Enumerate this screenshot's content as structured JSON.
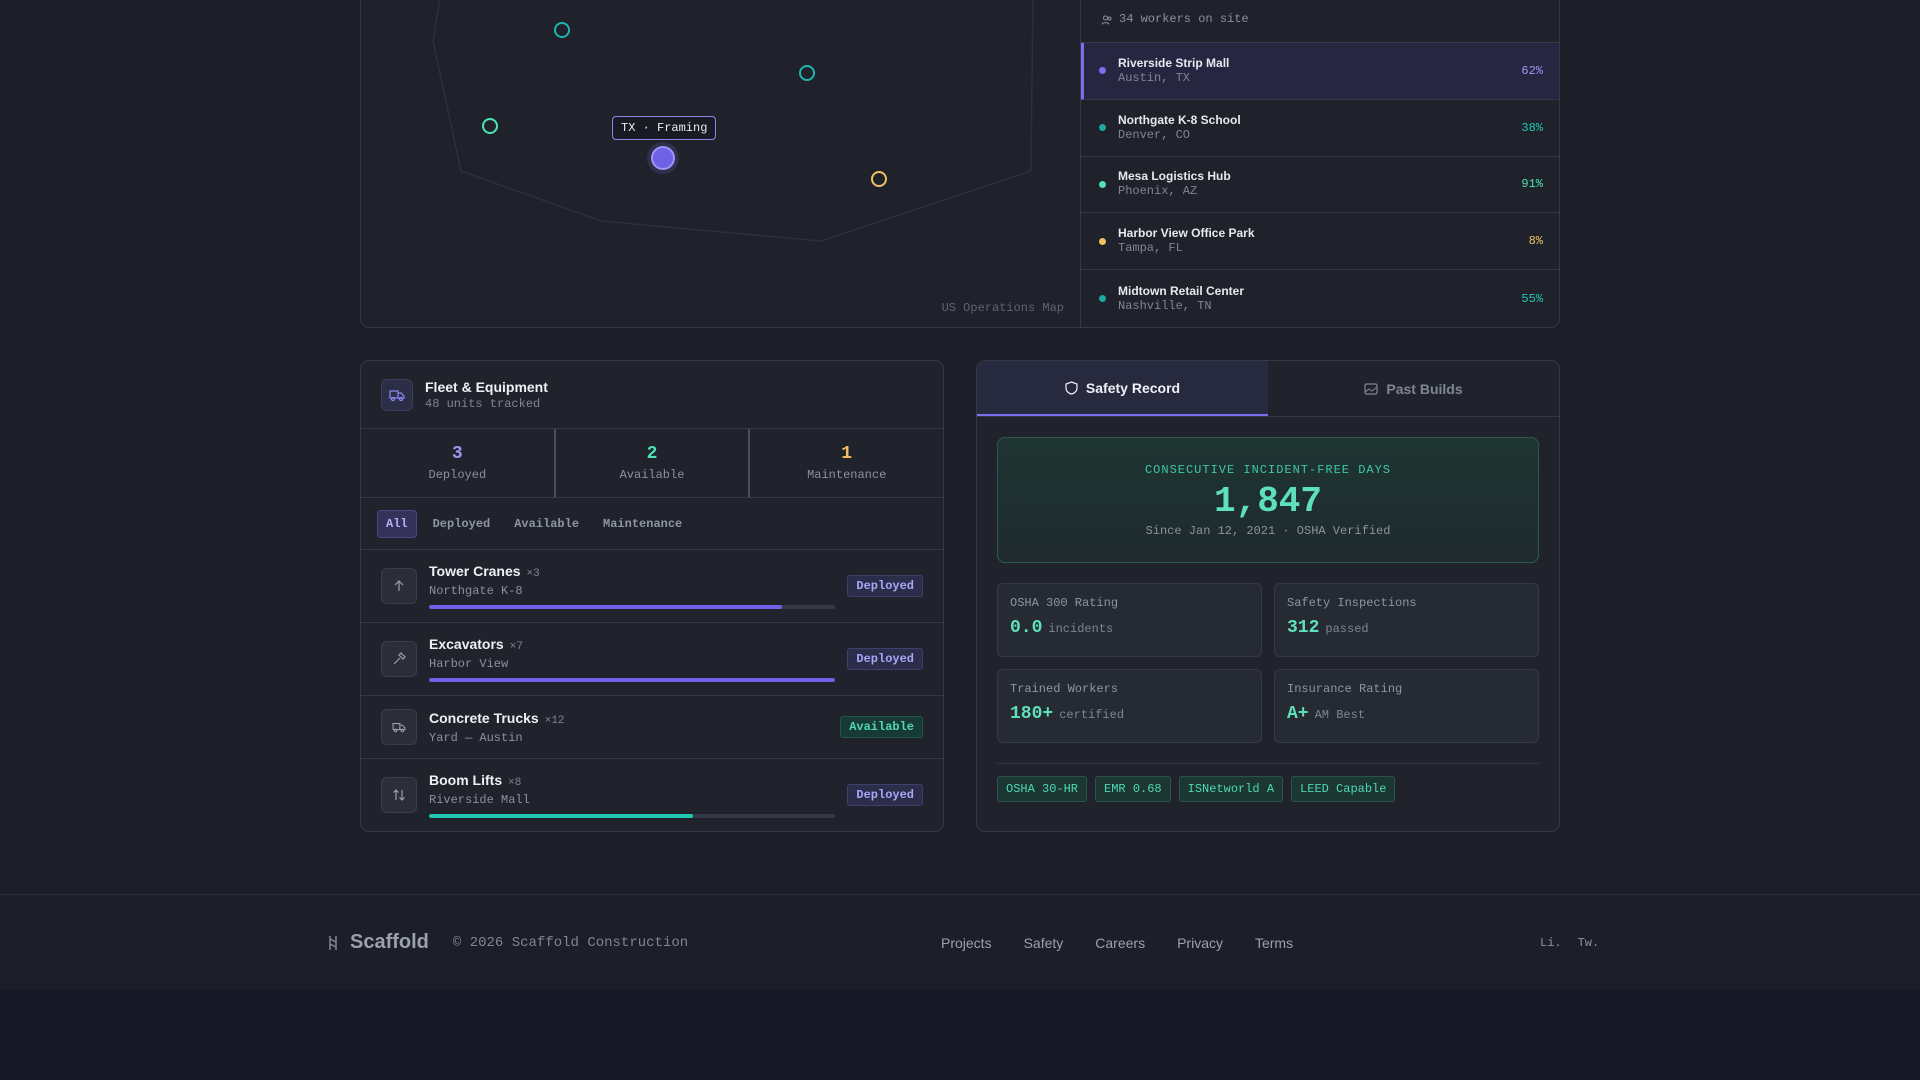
{
  "map": {
    "caption": "US Operations Map",
    "tooltip": "TX · Framing"
  },
  "sites": {
    "workers_label": "34 workers on site",
    "items": [
      {
        "name": "Riverside Strip Mall",
        "location": "Austin, TX",
        "progress": "62%",
        "color": "#7b6ef0"
      },
      {
        "name": "Northgate K-8 School",
        "location": "Denver, CO",
        "progress": "38%",
        "color": "#1aa8a0"
      },
      {
        "name": "Mesa Logistics Hub",
        "location": "Phoenix, AZ",
        "progress": "91%",
        "color": "#4fe0b8"
      },
      {
        "name": "Harbor View Office Park",
        "location": "Tampa, FL",
        "progress": "8%",
        "color": "#f2c063"
      },
      {
        "name": "Midtown Retail Center",
        "location": "Nashville, TN",
        "progress": "55%",
        "color": "#1aa8a0"
      }
    ]
  },
  "fleet": {
    "title": "Fleet & Equipment",
    "subtitle": "48 units tracked",
    "stats": [
      {
        "value": "3",
        "label": "Deployed",
        "color": "#9d96f5"
      },
      {
        "value": "2",
        "label": "Available",
        "color": "#4fe0b8"
      },
      {
        "value": "1",
        "label": "Maintenance",
        "color": "#f2c063"
      }
    ],
    "filters": [
      "All",
      "Deployed",
      "Available",
      "Maintenance"
    ],
    "items": [
      {
        "name": "Tower Cranes",
        "count": "×3",
        "location": "Northgate K-8",
        "status": "Deployed",
        "progress": 0.87,
        "bar_color": "#6f62e6",
        "icon": "arrow-up-icon"
      },
      {
        "name": "Excavators",
        "count": "×7",
        "location": "Harbor View",
        "status": "Deployed",
        "progress": 1.0,
        "bar_color": "#6f62e6",
        "icon": "hammer-icon"
      },
      {
        "name": "Concrete Trucks",
        "count": "×12",
        "location": "Yard — Austin",
        "status": "Available",
        "progress": null,
        "bar_color": null,
        "icon": "truck-icon"
      },
      {
        "name": "Boom Lifts",
        "count": "×8",
        "location": "Riverside Mall",
        "status": "Deployed",
        "progress": 0.65,
        "bar_color": "#22c7b4",
        "icon": "arrows-updown-icon"
      }
    ]
  },
  "safety": {
    "tabs": [
      "Safety Record",
      "Past Builds"
    ],
    "hero": {
      "label": "CONSECUTIVE INCIDENT-FREE DAYS",
      "value": "1,847",
      "sub": "Since Jan 12, 2021 · OSHA Verified"
    },
    "metrics": [
      {
        "label": "OSHA 300 Rating",
        "value": "0.0",
        "unit": "incidents"
      },
      {
        "label": "Safety Inspections",
        "value": "312",
        "unit": "passed"
      },
      {
        "label": "Trained Workers",
        "value": "180+",
        "unit": "certified"
      },
      {
        "label": "Insurance Rating",
        "value": "A+",
        "unit": "AM Best"
      }
    ],
    "certs": [
      "OSHA 30-HR",
      "EMR 0.68",
      "ISNetworld A",
      "LEED Capable"
    ]
  },
  "footer": {
    "brand": "Scaffold",
    "copyright": "© 2026 Scaffold Construction",
    "links": [
      "Projects",
      "Safety",
      "Careers",
      "Privacy",
      "Terms"
    ],
    "socials": [
      "Li.",
      "Tw."
    ]
  },
  "colors": {
    "accent": "#7b6ef0",
    "teal": "#4fe0b8",
    "amber": "#f2c063"
  }
}
